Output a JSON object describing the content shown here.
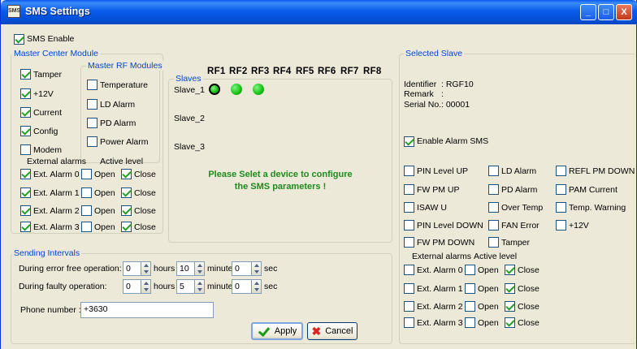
{
  "window": {
    "title": "SMS Settings",
    "controls": {
      "minimize": "_",
      "maximize": "□",
      "close": "X"
    }
  },
  "sms_enable": {
    "label": "SMS Enable",
    "checked": true
  },
  "master_center": {
    "title": "Master Center Module",
    "items": [
      {
        "label": "Tamper",
        "checked": true
      },
      {
        "label": "+12V",
        "checked": true
      },
      {
        "label": "Current",
        "checked": true
      },
      {
        "label": "Config",
        "checked": true
      },
      {
        "label": "Modem",
        "checked": false
      }
    ],
    "rf_title": "Master RF Modules",
    "rf_items": [
      {
        "label": "Temperature",
        "checked": false
      },
      {
        "label": "LD Alarm",
        "checked": false
      },
      {
        "label": "PD Alarm",
        "checked": false
      },
      {
        "label": "Power Alarm",
        "checked": false
      }
    ],
    "ext_header": "External alarms",
    "level_header": "Active level",
    "open_label": "Open",
    "close_label": "Close",
    "alarms": [
      {
        "label": "Ext. Alarm 0",
        "checked": true,
        "open": false,
        "close": true
      },
      {
        "label": "Ext. Alarm 1",
        "checked": true,
        "open": false,
        "close": true
      },
      {
        "label": "Ext. Alarm 2",
        "checked": true,
        "open": false,
        "close": true
      },
      {
        "label": "Ext. Alarm 3",
        "checked": true,
        "open": false,
        "close": true
      }
    ]
  },
  "slaves": {
    "title": "Slaves",
    "rf_headers": [
      "RF1",
      "RF2",
      "RF3",
      "RF4",
      "RF5",
      "RF6",
      "RF7",
      "RF8"
    ],
    "rows": [
      {
        "label": "Slave_1",
        "leds": 3
      },
      {
        "label": "Slave_2",
        "leds": 0
      },
      {
        "label": "Slave_3",
        "leds": 0
      }
    ],
    "message_line1": "Please Selet a device to configure",
    "message_line2": "the SMS parameters !"
  },
  "sending": {
    "title": "Sending Intervals",
    "error_free_label": "During error free operation:",
    "faulty_label": "During faulty operation:",
    "hours_label": "hours",
    "minutes_label": "minutes",
    "sec_label": "sec",
    "error_free": {
      "hours": "0",
      "minutes": "10",
      "sec": "0"
    },
    "faulty": {
      "hours": "0",
      "minutes": "5",
      "sec": "0"
    },
    "phone_label": "Phone number :",
    "phone_value": "+3630"
  },
  "buttons": {
    "apply": "Apply",
    "cancel": "Cancel"
  },
  "selected": {
    "title": "Selected Slave",
    "identifier_label": "Identifier",
    "identifier_value": ": RGF10",
    "remark_label": "Remark",
    "remark_value": ":",
    "serial_label": "Serial No.",
    "serial_value": ": 00001",
    "enable_alarm": {
      "label": "Enable Alarm SMS",
      "checked": true
    },
    "col1": [
      {
        "label": "PIN Level UP",
        "checked": false
      },
      {
        "label": "FW PM UP",
        "checked": false
      },
      {
        "label": "ISAW U",
        "checked": false
      },
      {
        "label": "PIN Level DOWN",
        "checked": false
      },
      {
        "label": "FW PM DOWN",
        "checked": false
      }
    ],
    "col2": [
      {
        "label": "LD Alarm",
        "checked": false
      },
      {
        "label": "PD Alarm",
        "checked": false
      },
      {
        "label": "Over Temp",
        "checked": false
      },
      {
        "label": "FAN Error",
        "checked": false
      },
      {
        "label": "Tamper",
        "checked": false
      }
    ],
    "col3": [
      {
        "label": "REFL PM DOWN",
        "checked": false
      },
      {
        "label": "PAM Current",
        "checked": false
      },
      {
        "label": "Temp. Warning",
        "checked": false
      },
      {
        "label": "+12V",
        "checked": false
      }
    ],
    "ext_header": "External alarms",
    "level_header": "Active level",
    "open_label": "Open",
    "close_label": "Close",
    "alarms": [
      {
        "label": "Ext. Alarm 0",
        "checked": false,
        "open": false,
        "close": true
      },
      {
        "label": "Ext. Alarm 1",
        "checked": false,
        "open": false,
        "close": true
      },
      {
        "label": "Ext. Alarm 2",
        "checked": false,
        "open": false,
        "close": true
      },
      {
        "label": "Ext. Alarm 3",
        "checked": false,
        "open": false,
        "close": true
      }
    ]
  }
}
